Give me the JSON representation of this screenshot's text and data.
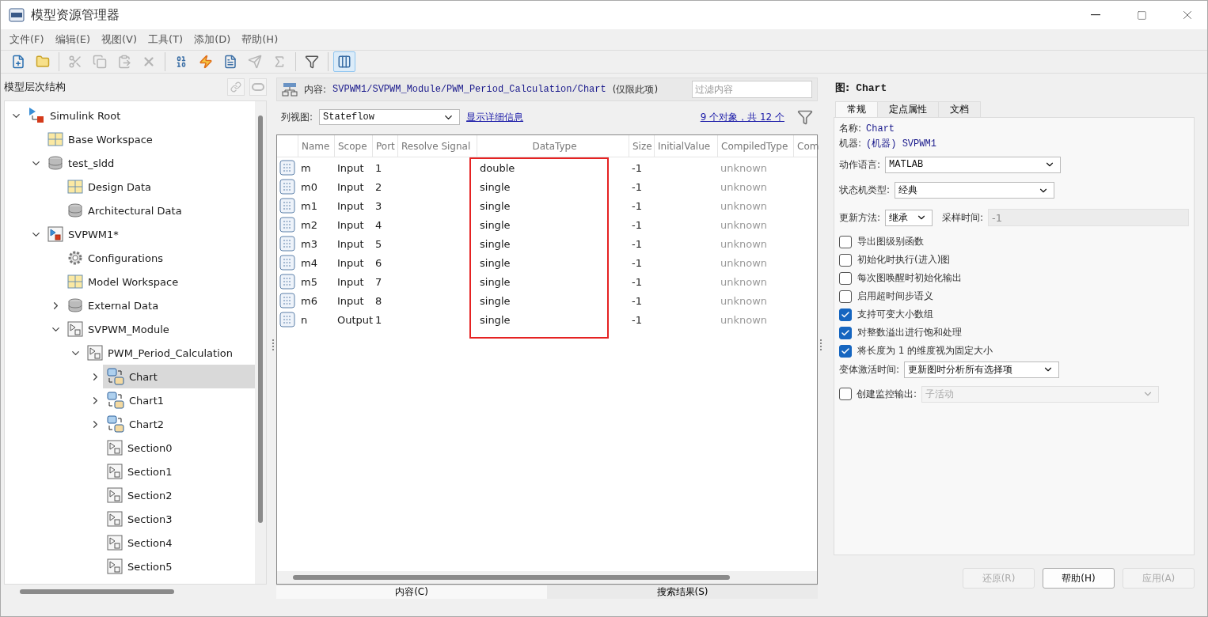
{
  "window": {
    "title": "模型资源管理器"
  },
  "menu": [
    "文件(F)",
    "编辑(E)",
    "视图(V)",
    "工具(T)",
    "添加(D)",
    "帮助(H)"
  ],
  "toolbar": [
    {
      "kind": "new-model",
      "disabled": false
    },
    {
      "kind": "open",
      "disabled": false
    },
    {
      "kind": "sep"
    },
    {
      "kind": "cut",
      "disabled": true
    },
    {
      "kind": "copy",
      "disabled": true
    },
    {
      "kind": "paste",
      "disabled": true
    },
    {
      "kind": "delete",
      "disabled": true
    },
    {
      "kind": "sep"
    },
    {
      "kind": "data",
      "disabled": false
    },
    {
      "kind": "event",
      "disabled": false
    },
    {
      "kind": "document",
      "disabled": false
    },
    {
      "kind": "message",
      "disabled": true
    },
    {
      "kind": "function",
      "disabled": true
    },
    {
      "kind": "sep"
    },
    {
      "kind": "filter",
      "disabled": false
    },
    {
      "kind": "sep"
    },
    {
      "kind": "columns",
      "disabled": false,
      "selected": true
    }
  ],
  "hierarchy": {
    "title": "模型层次结构",
    "tree": [
      {
        "label": "Simulink Root",
        "kind": "root",
        "expanded": true,
        "selected": false,
        "children": [
          {
            "label": "Base Workspace",
            "kind": "workspace",
            "selected": false
          },
          {
            "label": "test_sldd",
            "kind": "dictionary",
            "expanded": true,
            "selected": false,
            "children": [
              {
                "label": "Design Data",
                "kind": "design-data",
                "selected": false
              },
              {
                "label": "Architectural Data",
                "kind": "arch-data",
                "selected": false
              }
            ]
          },
          {
            "label": "SVPWM1*",
            "kind": "model",
            "expanded": true,
            "selected": false,
            "children": [
              {
                "label": "Configurations",
                "kind": "config",
                "selected": false
              },
              {
                "label": "Model Workspace",
                "kind": "model-workspace",
                "selected": false
              },
              {
                "label": "External Data",
                "kind": "external-data",
                "expanded": false,
                "selected": false
              },
              {
                "label": "SVPWM_Module",
                "kind": "subsystem",
                "expanded": true,
                "selected": false,
                "children": [
                  {
                    "label": "PWM_Period_Calculation",
                    "kind": "subsystem",
                    "expanded": true,
                    "selected": false,
                    "children": [
                      {
                        "label": "Chart",
                        "kind": "chart",
                        "expanded": false,
                        "selected": true
                      },
                      {
                        "label": "Chart1",
                        "kind": "chart",
                        "expanded": false,
                        "selected": false
                      },
                      {
                        "label": "Chart2",
                        "kind": "chart",
                        "expanded": false,
                        "selected": false
                      },
                      {
                        "label": "Section0",
                        "kind": "subsystem",
                        "selected": false
                      },
                      {
                        "label": "Section1",
                        "kind": "subsystem",
                        "selected": false
                      },
                      {
                        "label": "Section2",
                        "kind": "subsystem",
                        "selected": false
                      },
                      {
                        "label": "Section3",
                        "kind": "subsystem",
                        "selected": false
                      },
                      {
                        "label": "Section4",
                        "kind": "subsystem",
                        "selected": false
                      },
                      {
                        "label": "Section5",
                        "kind": "subsystem",
                        "selected": false
                      }
                    ]
                  }
                ]
              }
            ]
          }
        ]
      }
    ]
  },
  "contents": {
    "label": "内容:",
    "path": "SVPWM1/SVPWM_Module/PWM_Period_Calculation/Chart",
    "scope": "(仅限此项)",
    "filter": {
      "placeholder": "过滤内容"
    },
    "view_label": "列视图:",
    "view": "Stateflow",
    "details_link": "显示详细信息",
    "count_link": "9 个对象，共 12 个",
    "columns": [
      {
        "label": "Name",
        "highlighted": false
      },
      {
        "label": "Scope",
        "highlighted": false
      },
      {
        "label": "Port",
        "highlighted": false
      },
      {
        "label": "Resolve Signal",
        "highlighted": false
      },
      {
        "label": "DataType",
        "highlighted": true
      },
      {
        "label": "Size",
        "highlighted": false
      },
      {
        "label": "InitialValue",
        "highlighted": false
      },
      {
        "label": "CompiledType",
        "highlighted": false
      },
      {
        "label": "Com",
        "highlighted": false
      }
    ],
    "rows": [
      {
        "cells": [
          "m",
          "Input",
          "1",
          "",
          "double",
          "-1",
          "",
          "unknown",
          ""
        ]
      },
      {
        "cells": [
          "m0",
          "Input",
          "2",
          "",
          "single",
          "-1",
          "",
          "unknown",
          ""
        ]
      },
      {
        "cells": [
          "m1",
          "Input",
          "3",
          "",
          "single",
          "-1",
          "",
          "unknown",
          ""
        ]
      },
      {
        "cells": [
          "m2",
          "Input",
          "4",
          "",
          "single",
          "-1",
          "",
          "unknown",
          ""
        ]
      },
      {
        "cells": [
          "m3",
          "Input",
          "5",
          "",
          "single",
          "-1",
          "",
          "unknown",
          ""
        ]
      },
      {
        "cells": [
          "m4",
          "Input",
          "6",
          "",
          "single",
          "-1",
          "",
          "unknown",
          ""
        ]
      },
      {
        "cells": [
          "m5",
          "Input",
          "7",
          "",
          "single",
          "-1",
          "",
          "unknown",
          ""
        ]
      },
      {
        "cells": [
          "m6",
          "Input",
          "8",
          "",
          "single",
          "-1",
          "",
          "unknown",
          ""
        ]
      },
      {
        "cells": [
          "n",
          "Output",
          "1",
          "",
          "single",
          "-1",
          "",
          "unknown",
          ""
        ]
      }
    ],
    "tabs": [
      {
        "label": "内容(C)",
        "selected": true
      },
      {
        "label": "搜索结果(S)",
        "selected": false
      }
    ]
  },
  "properties": {
    "heading": "图:",
    "object": "Chart",
    "tabs": [
      {
        "label": "常规",
        "selected": true
      },
      {
        "label": "定点属性",
        "selected": false
      },
      {
        "label": "文档",
        "selected": false
      }
    ],
    "name_label": "名称:",
    "name": "Chart",
    "machine_label": "机器:",
    "machine": "(机器) SVPWM1",
    "action_language": {
      "label": "动作语言:",
      "value": "MATLAB"
    },
    "state_machine": {
      "label": "状态机类型:",
      "value": "经典"
    },
    "update_method": {
      "label": "更新方法:",
      "value": "继承"
    },
    "sample_time": {
      "label": "采样时间:",
      "value": "-1",
      "disabled": true
    },
    "options": [
      {
        "label": "导出图级别函数",
        "checked": false
      },
      {
        "label": "初始化时执行(进入)图",
        "checked": false
      },
      {
        "label": "每次图唤醒时初始化输出",
        "checked": false
      },
      {
        "label": "启用超时间步语义",
        "checked": false
      },
      {
        "label": "支持可变大小数组",
        "checked": true
      },
      {
        "label": "对整数溢出进行饱和处理",
        "checked": true
      },
      {
        "label": "将长度为 1 的维度视为固定大小",
        "checked": true
      }
    ],
    "variant": {
      "label": "变体激活时间:",
      "value": "更新图时分析所有选择项"
    },
    "monitor": {
      "label": "创建监控输出:",
      "checked": false,
      "value": "子活动",
      "disabled": true
    },
    "buttons": [
      {
        "label": "还原(R)",
        "disabled": true
      },
      {
        "label": "帮助(H)",
        "disabled": false
      },
      {
        "label": "应用(A)",
        "disabled": true
      }
    ]
  }
}
